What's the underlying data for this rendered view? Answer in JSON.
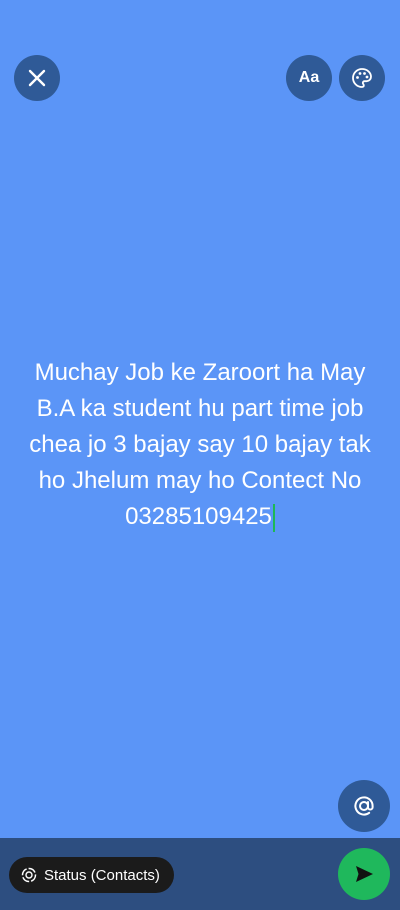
{
  "toolbar": {
    "close_icon": "close-icon",
    "font_label": "Aa",
    "palette_icon": "palette-icon"
  },
  "status": {
    "text": "Muchay Job ke Zaroort ha May B.A ka student hu part time job chea jo 3 bajay say 10 bajay tak ho Jhelum may ho Contect No 03285109425"
  },
  "mention": {
    "icon": "at-sign-icon"
  },
  "bottom": {
    "audience_label": "Status (Contacts)",
    "audience_icon": "status-ring-icon",
    "send_icon": "send-icon"
  },
  "colors": {
    "background": "#5b95f7",
    "button_bg": "#2f5a97",
    "bottom_bar": "#2d4e80",
    "chip_bg": "#1b1b1b",
    "send_bg": "#1fb85c",
    "caret": "#1db954"
  }
}
